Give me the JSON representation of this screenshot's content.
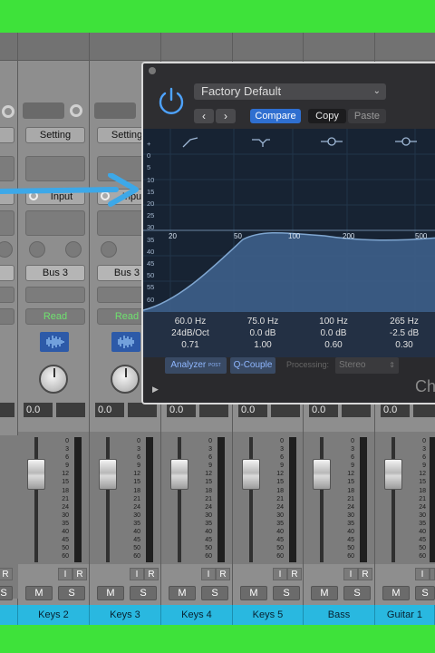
{
  "strips": [
    {
      "setting": "",
      "input": "",
      "bus": "",
      "read": "",
      "volume": "",
      "name": "",
      "scale": []
    },
    {
      "setting": "Setting",
      "input": "Input",
      "bus": "Bus 3",
      "read": "Read",
      "volume": "0.0",
      "name": "Keys 2"
    },
    {
      "setting": "Setting",
      "input": "Input",
      "bus": "Bus 3",
      "read": "Read",
      "volume": "0.0",
      "name": "Keys 3"
    },
    {
      "volume": "0.0",
      "name": "Keys 4"
    },
    {
      "volume": "0.0",
      "name": "Keys 5"
    },
    {
      "volume": "0.0",
      "name": "Bass"
    },
    {
      "volume": "0.0",
      "name": "Guitar 1"
    }
  ],
  "fader_scale": [
    "0",
    "3",
    "6",
    "9",
    "12",
    "15",
    "18",
    "21",
    "24",
    "30",
    "35",
    "40",
    "45",
    "50",
    "60"
  ],
  "strip_buttons": {
    "i": "I",
    "r": "R",
    "m": "M",
    "s": "S"
  },
  "plugin": {
    "preset": "Factory Default",
    "nav_prev": "‹",
    "nav_next": "›",
    "compare": "Compare",
    "copy": "Copy",
    "paste": "Paste",
    "db_scale": [
      "+",
      "0",
      "5",
      "10",
      "15",
      "20",
      "25",
      "30",
      "35",
      "40",
      "45",
      "50",
      "55",
      "60",
      "-"
    ],
    "freq_labels": [
      "20",
      "50",
      "100",
      "200",
      "500"
    ],
    "bands": [
      {
        "freq": "60.0 Hz",
        "gain": "24dB/Oct",
        "q": "0.71"
      },
      {
        "freq": "75.0 Hz",
        "gain": "0.0 dB",
        "q": "1.00"
      },
      {
        "freq": "100 Hz",
        "gain": "0.0 dB",
        "q": "0.60"
      },
      {
        "freq": "265 Hz",
        "gain": "-2.5 dB",
        "q": "0.30"
      }
    ],
    "analyzer": "Analyzer",
    "analyzer_post": "POST",
    "q_couple": "Q-Couple",
    "processing_label": "Processing:",
    "processing_value": "Stereo",
    "footer_text": "Ch"
  },
  "colors": {
    "green_border": "#3ee23a",
    "channel_name_bg": "#29b8e0",
    "accent_blue": "#2f6fd0",
    "read_green": "#6fe26f"
  }
}
